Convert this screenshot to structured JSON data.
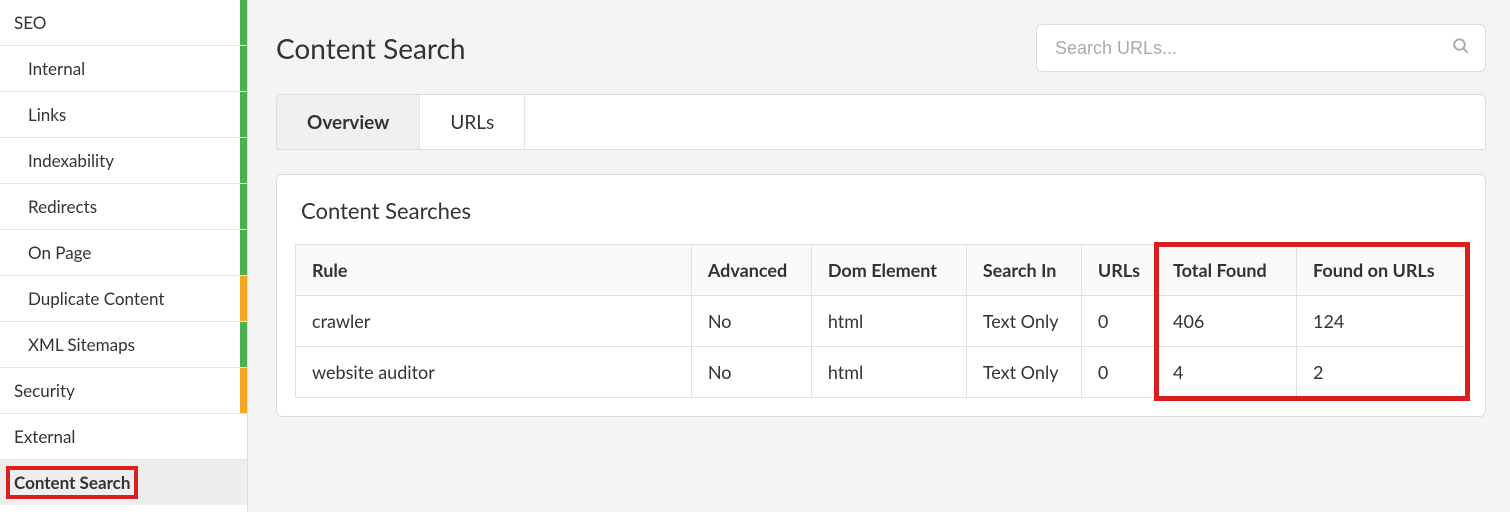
{
  "sidebar": {
    "items": [
      {
        "label": "SEO",
        "sub": false,
        "marker": "green"
      },
      {
        "label": "Internal",
        "sub": true,
        "marker": "green"
      },
      {
        "label": "Links",
        "sub": true,
        "marker": "green"
      },
      {
        "label": "Indexability",
        "sub": true,
        "marker": "green"
      },
      {
        "label": "Redirects",
        "sub": true,
        "marker": "green"
      },
      {
        "label": "On Page",
        "sub": true,
        "marker": "green"
      },
      {
        "label": "Duplicate Content",
        "sub": true,
        "marker": "orange"
      },
      {
        "label": "XML Sitemaps",
        "sub": true,
        "marker": "green"
      },
      {
        "label": "Security",
        "sub": false,
        "marker": "orange"
      },
      {
        "label": "External",
        "sub": false,
        "marker": ""
      },
      {
        "label": "Content Search",
        "sub": false,
        "marker": "",
        "active": true,
        "highlight": true
      }
    ]
  },
  "page": {
    "title": "Content Search",
    "search_placeholder": "Search URLs..."
  },
  "tabs": [
    {
      "label": "Overview",
      "active": true
    },
    {
      "label": "URLs",
      "active": false
    }
  ],
  "panel": {
    "title": "Content Searches",
    "columns": [
      "Rule",
      "Advanced",
      "Dom Element",
      "Search In",
      "URLs",
      "Total Found",
      "Found on URLs"
    ],
    "rows": [
      {
        "rule": "crawler",
        "advanced": "No",
        "dom": "html",
        "search_in": "Text Only",
        "urls": "0",
        "total_found": "406",
        "found_on": "124"
      },
      {
        "rule": "website auditor",
        "advanced": "No",
        "dom": "html",
        "search_in": "Text Only",
        "urls": "0",
        "total_found": "4",
        "found_on": "2"
      }
    ]
  }
}
